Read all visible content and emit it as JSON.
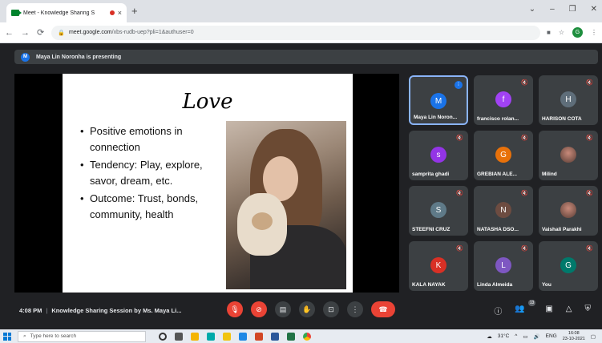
{
  "browser": {
    "tab_title": "Meet - Knowledge Sharing S",
    "tab_close": "×",
    "new_tab": "+",
    "url_host": "meet.google.com",
    "url_path": "/xbs-rudb-uep?pli=1&authuser=0",
    "profile_initial": "G",
    "window_controls": [
      "⌄",
      "–",
      "❐",
      "✕"
    ]
  },
  "banner": {
    "avatar_initial": "M",
    "text": "Maya Lin Noronha is presenting"
  },
  "slide": {
    "title": "Love",
    "bullets": [
      "Positive emotions in connection",
      "Tendency: Play, explore, savor, dream, etc.",
      "Outcome: Trust, bonds, community, health"
    ]
  },
  "participants": [
    {
      "initial": "M",
      "name": "Maya Lin Noron...",
      "color": "#1a73e8",
      "speaking": true,
      "muted": false
    },
    {
      "initial": "f",
      "name": "francisco rolan...",
      "color": "#a142f4",
      "speaking": false,
      "muted": true
    },
    {
      "initial": "H",
      "name": "HARISON COTA",
      "color": "#5f6e7a",
      "speaking": false,
      "muted": true
    },
    {
      "initial": "s",
      "name": "samprita ghadi",
      "color": "#9334e6",
      "speaking": false,
      "muted": true
    },
    {
      "initial": "G",
      "name": "GREBIAN ALE...",
      "color": "#e8710a",
      "speaking": false,
      "muted": true
    },
    {
      "initial": "",
      "name": "Milind",
      "color": "#7a5c4d",
      "speaking": false,
      "muted": true,
      "photo": true
    },
    {
      "initial": "S",
      "name": "STEEFNI CRUZ",
      "color": "#5f7a88",
      "speaking": false,
      "muted": true
    },
    {
      "initial": "N",
      "name": "NATASHA DSO...",
      "color": "#6d4c41",
      "speaking": false,
      "muted": true
    },
    {
      "initial": "",
      "name": "Vaishali Parakhi",
      "color": "#7a8a5c",
      "speaking": false,
      "muted": true,
      "photo": true
    },
    {
      "initial": "K",
      "name": "KALA NAYAK",
      "color": "#d93025",
      "speaking": false,
      "muted": true
    },
    {
      "initial": "L",
      "name": "Linda Almeida",
      "color": "#7e57c2",
      "speaking": false,
      "muted": true
    },
    {
      "initial": "G",
      "name": "You",
      "color": "#00796b",
      "speaking": false,
      "muted": true
    }
  ],
  "controls": {
    "time": "4:08 PM",
    "separator": "|",
    "meeting_title": "Knowledge Sharing Session by Ms. Maya Li...",
    "people_count": "13"
  },
  "taskbar": {
    "search_placeholder": "Type here to search",
    "weather": "31°C",
    "language": "ENG",
    "time": "16:08",
    "date": "23-10-2021"
  }
}
